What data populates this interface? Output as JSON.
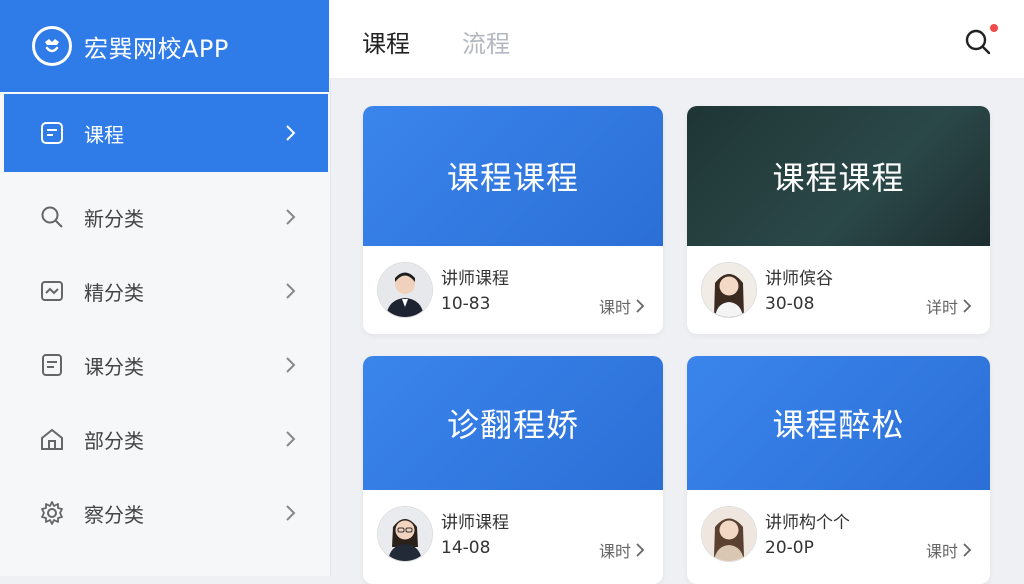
{
  "app": {
    "title": "宏巽网校APP"
  },
  "sidebar": {
    "items": [
      {
        "label": "课程",
        "icon": "document-icon",
        "active": true
      },
      {
        "label": "新分类",
        "icon": "search-icon"
      },
      {
        "label": "精分类",
        "icon": "image-icon"
      },
      {
        "label": "课分类",
        "icon": "list-icon"
      },
      {
        "label": "部分类",
        "icon": "home-icon"
      },
      {
        "label": "察分类",
        "icon": "gear-icon"
      }
    ]
  },
  "header": {
    "tabs": [
      {
        "label": "课程"
      },
      {
        "label": "流程"
      }
    ],
    "search_icon": "search-icon",
    "notification_color": "#f04b4b"
  },
  "cards": [
    {
      "title": "课程课程",
      "teacher": "讲师课程",
      "count": "10-83",
      "hours_label": "课时",
      "theme": "blue"
    },
    {
      "title": "课程课程",
      "teacher": "讲师傧谷",
      "count": "30-08",
      "hours_label": "详时",
      "theme": "dark"
    },
    {
      "title": "诊翻程娇",
      "teacher": "讲师课程",
      "count": "14-08",
      "hours_label": "课时",
      "theme": "blue"
    },
    {
      "title": "课程醉松",
      "teacher": "讲师构个个",
      "count": "20-0P",
      "hours_label": "课时",
      "theme": "blue"
    }
  ],
  "colors": {
    "brand": "#2f7be8",
    "sidebar_bg": "#f6f7f9",
    "content_bg": "#eef0f4"
  }
}
